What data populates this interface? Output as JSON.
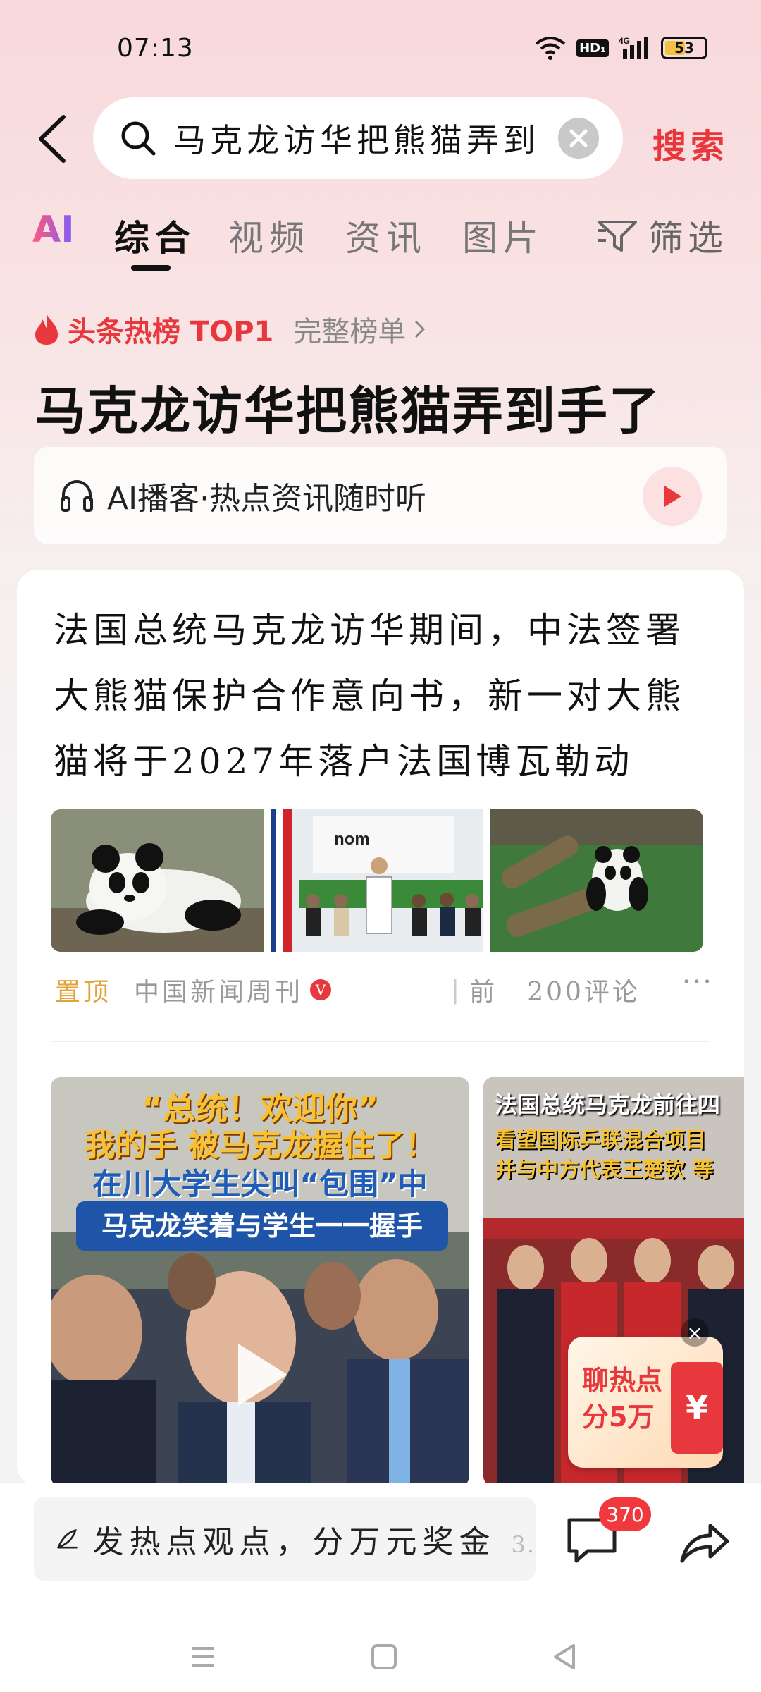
{
  "status": {
    "time": "07:13",
    "hd": "HD₁",
    "network": "4G",
    "battery": "53"
  },
  "search": {
    "query": "马克龙访华把熊猫弄到",
    "button": "搜索"
  },
  "tabs": {
    "ai": "AI",
    "items": [
      "综合",
      "视频",
      "资讯",
      "图片"
    ],
    "active": "综合",
    "filter": "筛选"
  },
  "hot": {
    "label": "头条热榜 TOP1",
    "more": "完整榜单",
    "title": "马克龙访华把熊猫弄到手了"
  },
  "podcast": {
    "text": "AI播客·热点资讯随时听"
  },
  "article": {
    "text": "法国总统马克龙访华期间，中法签署大熊猫保护合作意向书，新一对大熊猫将于2027年落户法国博瓦勒动物...",
    "pinned": "置顶",
    "source": "中国新闻周刊",
    "time": "前",
    "comments": "200评论",
    "more": "···"
  },
  "videos": [
    {
      "captions": [
        "“总统！欢迎你”",
        "我的手 被马克龙握住了！",
        "在川大学生尖叫“包围”中",
        "马克龙笑着与学生一一握手"
      ]
    },
    {
      "captions": [
        "法国总统马克龙前往四",
        "看望国际乒联混合项目",
        "并与中方代表王楚钦 等"
      ]
    }
  ],
  "promo": {
    "text1": "聊热点",
    "text2": "分5万",
    "symbol": "¥"
  },
  "bottom": {
    "comment_placeholder": "发热点观点，分万元奖金",
    "comment_fade": "3.",
    "comment_count": "370"
  },
  "colors": {
    "accent": "#e8383d",
    "pinned": "#e2a43a"
  }
}
